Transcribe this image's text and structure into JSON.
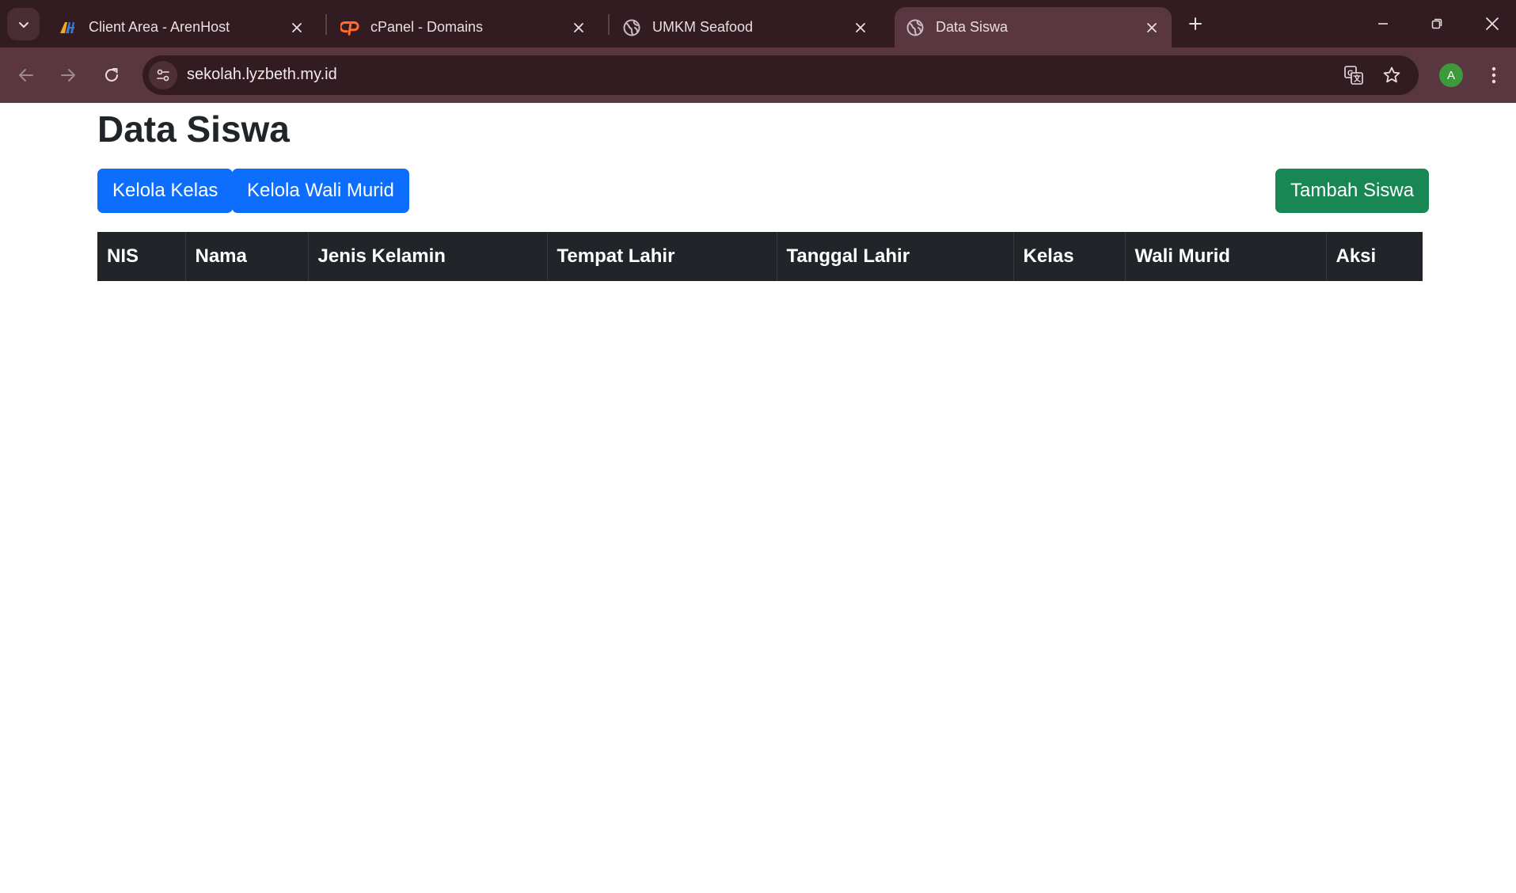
{
  "browser": {
    "tabs": [
      {
        "title": "Client Area - ArenHost",
        "favicon": "arenhost-logo-icon",
        "active": false
      },
      {
        "title": "cPanel - Domains",
        "favicon": "cpanel-logo-icon",
        "active": false
      },
      {
        "title": "UMKM Seafood",
        "favicon": "globe-icon",
        "active": false
      },
      {
        "title": "Data Siswa",
        "favicon": "globe-icon",
        "active": true
      }
    ],
    "address": "sekolah.lyzbeth.my.id",
    "profile_initial": "A",
    "colors": {
      "titlebar": "#331b22",
      "toolbar": "#5a3640",
      "profile": "#3d9a3a"
    }
  },
  "page": {
    "title": "Data Siswa",
    "buttons": {
      "kelola_kelas": "Kelola Kelas",
      "kelola_wali_murid": "Kelola Wali Murid",
      "tambah_siswa": "Tambah Siswa"
    },
    "table": {
      "columns": [
        "NIS",
        "Nama",
        "Jenis Kelamin",
        "Tempat Lahir",
        "Tanggal Lahir",
        "Kelas",
        "Wali Murid",
        "Aksi"
      ],
      "rows": []
    },
    "colors": {
      "primary": "#0d6efd",
      "success": "#198754",
      "table_header": "#212529"
    }
  }
}
